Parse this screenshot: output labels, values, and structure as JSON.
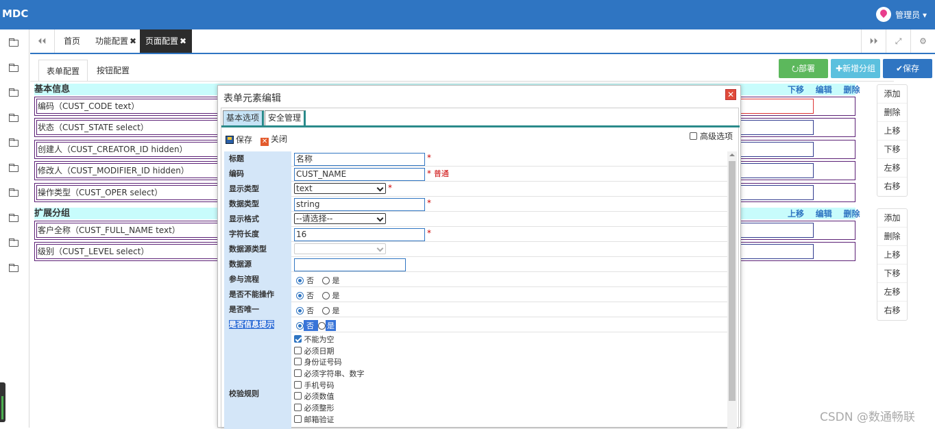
{
  "app": {
    "brand": "MDC",
    "user": "管理员 ▾"
  },
  "tabs": {
    "nav_prev": "⏴⏴",
    "items": [
      {
        "label": "首页",
        "close": ""
      },
      {
        "label": "功能配置",
        "close": "✖"
      },
      {
        "label": "页面配置",
        "close": "✖"
      }
    ],
    "nav_next": "⏵⏵",
    "fullscreen": "⤢",
    "settings": "⚙"
  },
  "subtabs": [
    "表单配置",
    "按钮配置"
  ],
  "top_buttons": {
    "deploy": "⭮部署",
    "add_group": "✚新增分组",
    "save": "✔保存"
  },
  "sections": [
    {
      "title": "基本信息",
      "actions": [
        "下移",
        "编辑",
        "删除"
      ],
      "rows": [
        "编码（CUST_CODE  text）",
        "状态（CUST_STATE  select）",
        "创建人（CUST_CREATOR_ID  hidden）",
        "修改人（CUST_MODIFIER_ID  hidden）",
        "操作类型（CUST_OPER  select）"
      ]
    },
    {
      "title": "扩展分组",
      "actions": [
        "上移",
        "编辑",
        "删除"
      ],
      "rows": [
        "客户全称（CUST_FULL_NAME  text）",
        "级别（CUST_LEVEL  select）"
      ]
    }
  ],
  "side_buttons": [
    "添加",
    "删除",
    "上移",
    "下移",
    "左移",
    "右移"
  ],
  "dialog": {
    "title": "表单元素编辑",
    "close": "✕",
    "tabs": [
      "基本选项",
      "安全管理"
    ],
    "toolbar": {
      "save": "保存",
      "close": "关闭"
    },
    "advanced": "高级选项",
    "fields": {
      "title_label": "标题",
      "title_value": "名称",
      "code_label": "编码",
      "code_value": "CUST_NAME",
      "code_note": "普通",
      "display_type_label": "显示类型",
      "display_type_value": "text",
      "data_type_label": "数据类型",
      "data_type_value": "string",
      "display_format_label": "显示格式",
      "display_format_value": "--请选择--",
      "length_label": "字符长度",
      "length_value": "16",
      "ds_type_label": "数据源类型",
      "ds_label": "数据源",
      "flow_label": "参与流程",
      "readonly_label": "是否不能操作",
      "unique_label": "是否唯一",
      "tip_label": "是否信息提示",
      "validate_label": "校验规则"
    },
    "radio_no": "否",
    "radio_yes": "是",
    "required_mark": "*",
    "rules": [
      {
        "label": "不能为空",
        "checked": true
      },
      {
        "label": "必须日期",
        "checked": false
      },
      {
        "label": "身份证号码",
        "checked": false
      },
      {
        "label": "必须字符串、数字",
        "checked": false
      },
      {
        "label": "手机号码",
        "checked": false
      },
      {
        "label": "必须数值",
        "checked": false
      },
      {
        "label": "必须整形",
        "checked": false
      },
      {
        "label": "邮箱验证",
        "checked": false
      }
    ]
  },
  "watermark": "CSDN @数通畅联"
}
